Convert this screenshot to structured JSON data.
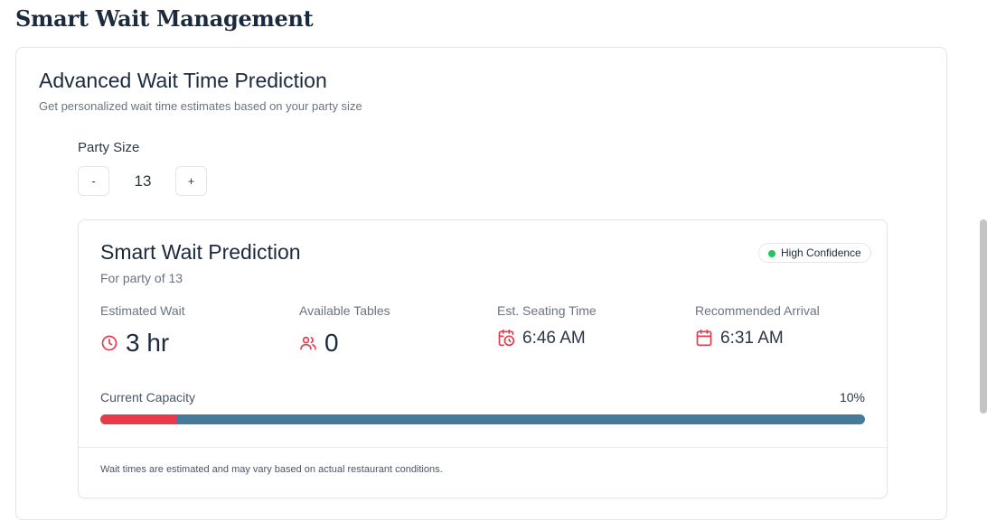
{
  "page": {
    "title": "Smart Wait Management"
  },
  "section": {
    "title": "Advanced Wait Time Prediction",
    "subtitle": "Get personalized wait time estimates based on your party size"
  },
  "party": {
    "label": "Party Size",
    "value": "13",
    "decrement_label": "-",
    "increment_label": "+"
  },
  "prediction": {
    "title": "Smart Wait Prediction",
    "subtitle": "For party of 13",
    "badge": {
      "label": "High Confidence",
      "dot_color": "#22c55e"
    },
    "stats": [
      {
        "label": "Estimated Wait",
        "value": "3 hr",
        "icon": "clock-icon"
      },
      {
        "label": "Available Tables",
        "value": "0",
        "icon": "users-icon"
      },
      {
        "label": "Est. Seating Time",
        "value": "6:46 AM",
        "icon": "calendar-clock-icon"
      },
      {
        "label": "Recommended Arrival",
        "value": "6:31 AM",
        "icon": "calendar-icon"
      }
    ],
    "capacity": {
      "label": "Current Capacity",
      "percent_label": "10%",
      "fraction": 0.1,
      "fill_color": "#e83a4b",
      "track_color": "#467a9c"
    },
    "footnote": "Wait times are estimated and may vary based on actual restaurant conditions."
  },
  "colors": {
    "accent_red": "#e83a4b",
    "text_dark": "#1c2a3d"
  }
}
